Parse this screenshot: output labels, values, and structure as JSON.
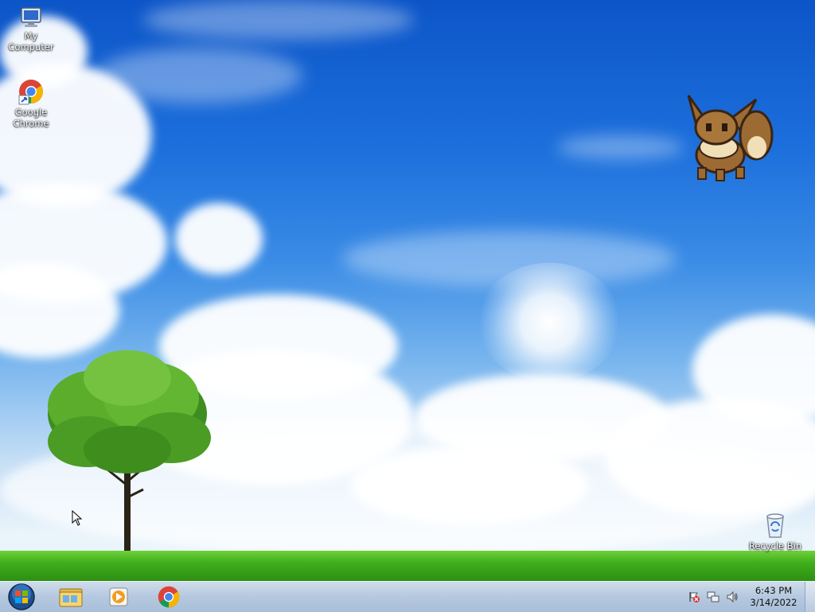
{
  "desktop": {
    "icons": [
      {
        "label": "My Computer"
      },
      {
        "label": "Google Chrome"
      },
      {
        "label": "Recycle Bin"
      }
    ]
  },
  "taskbar": {
    "start_icon": "windows-orb-icon",
    "pinned": [
      {
        "name": "file-explorer",
        "icon": "folder-icon"
      },
      {
        "name": "media-player",
        "icon": "media-player-icon"
      },
      {
        "name": "chrome",
        "icon": "chrome-icon"
      }
    ],
    "tray": {
      "icons": [
        "action-center-flag-icon",
        "network-icon",
        "volume-icon"
      ],
      "time": "6:43 PM",
      "date": "3/14/2022"
    }
  },
  "colors": {
    "sky_top": "#0c55c8",
    "grass": "#3fae1c",
    "taskbar": "#b5c8df"
  }
}
